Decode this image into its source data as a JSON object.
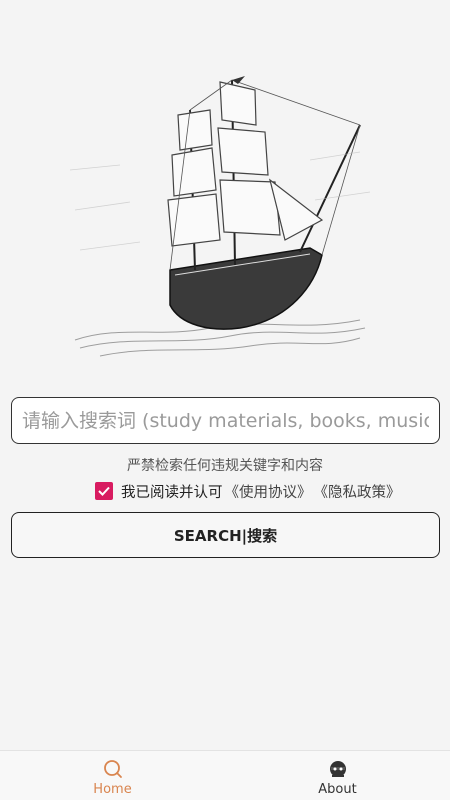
{
  "hero": {
    "image": "sailing-ship-sketch"
  },
  "search": {
    "placeholder": "请输入搜索词 (study materials, books, music, ...",
    "value": ""
  },
  "notice": "严禁检索任何违规关键字和内容",
  "agreement": {
    "checked": true,
    "text": "我已阅读并认可",
    "terms_link": "《使用协议》",
    "privacy_link": "《隐私政策》"
  },
  "search_button": {
    "label": "SEARCH|搜索"
  },
  "nav": {
    "items": [
      {
        "label": "Home",
        "icon": "search-icon",
        "active": true
      },
      {
        "label": "About",
        "icon": "pirate-icon",
        "active": false
      }
    ]
  },
  "colors": {
    "accent": "#d81b60",
    "nav_active": "#d9854f"
  }
}
